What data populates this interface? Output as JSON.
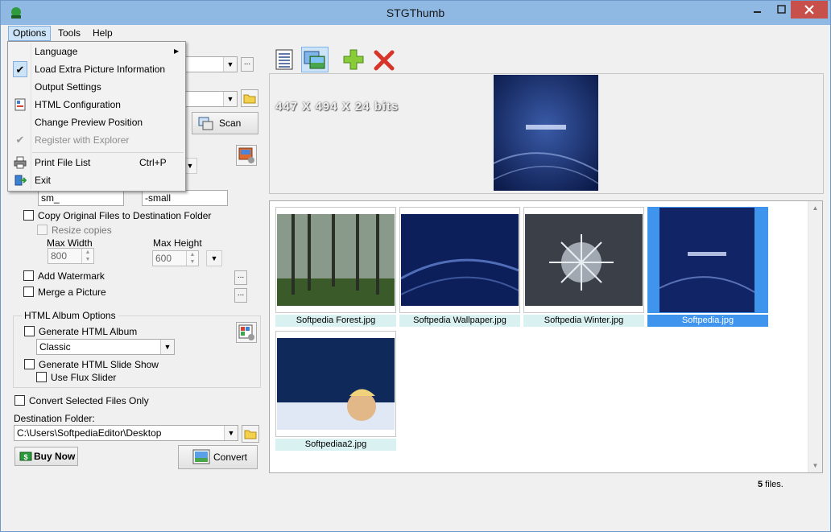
{
  "window": {
    "title": "STGThumb"
  },
  "menubar": {
    "options": "Options",
    "tools": "Tools",
    "help": "Help"
  },
  "dropdown": {
    "items": [
      {
        "label": "Language",
        "submenu": true
      },
      {
        "label": "Load Extra Picture Information",
        "checked": true
      },
      {
        "label": "Output Settings"
      },
      {
        "label": "HTML Configuration"
      },
      {
        "label": "Change Preview Position"
      },
      {
        "label": "Register with Explorer",
        "disabled": true,
        "checked": true
      },
      {
        "label": "Print File List",
        "shortcut": "Ctrl+P"
      },
      {
        "label": "Exit"
      }
    ]
  },
  "left": {
    "scan_label": "Scan",
    "prefix_value": "sm_",
    "suffix_value": "-small",
    "copy_original_label": "Copy Original Files to Destination Folder",
    "resize_copies_label": "Resize copies",
    "max_width_label": "Max Width",
    "max_height_label": "Max Height",
    "max_width_value": "800",
    "max_height_value": "600",
    "add_watermark_label": "Add Watermark",
    "merge_picture_label": "Merge a Picture",
    "html_album_group": "HTML Album Options",
    "generate_album_label": "Generate HTML Album",
    "album_style_value": "Classic",
    "generate_slideshow_label": "Generate HTML Slide Show",
    "use_flux_label": "Use Flux Slider",
    "convert_selected_label": "Convert Selected Files Only",
    "destination_label": "Destination Folder:",
    "destination_value": "C:\\Users\\SoftpediaEditor\\Desktop",
    "buy_now_label": "Buy Now",
    "convert_label": "Convert",
    "ellipsis": "..."
  },
  "preview": {
    "info": "447 X 494 X 24 bits"
  },
  "thumbnails": [
    {
      "name": "Softpedia Forest.jpg"
    },
    {
      "name": "Softpedia Wallpaper.jpg"
    },
    {
      "name": "Softpedia Winter.jpg"
    },
    {
      "name": "Softpedia.jpg",
      "selected": true
    },
    {
      "name": "Softpediaa2.jpg"
    }
  ],
  "status": {
    "count": "5",
    "suffix": " files."
  },
  "colors": {
    "accent": "#3f94ee",
    "caption_bg": "#d9f1f1",
    "title_bar": "#8fb8e3",
    "close": "#c7504b"
  }
}
